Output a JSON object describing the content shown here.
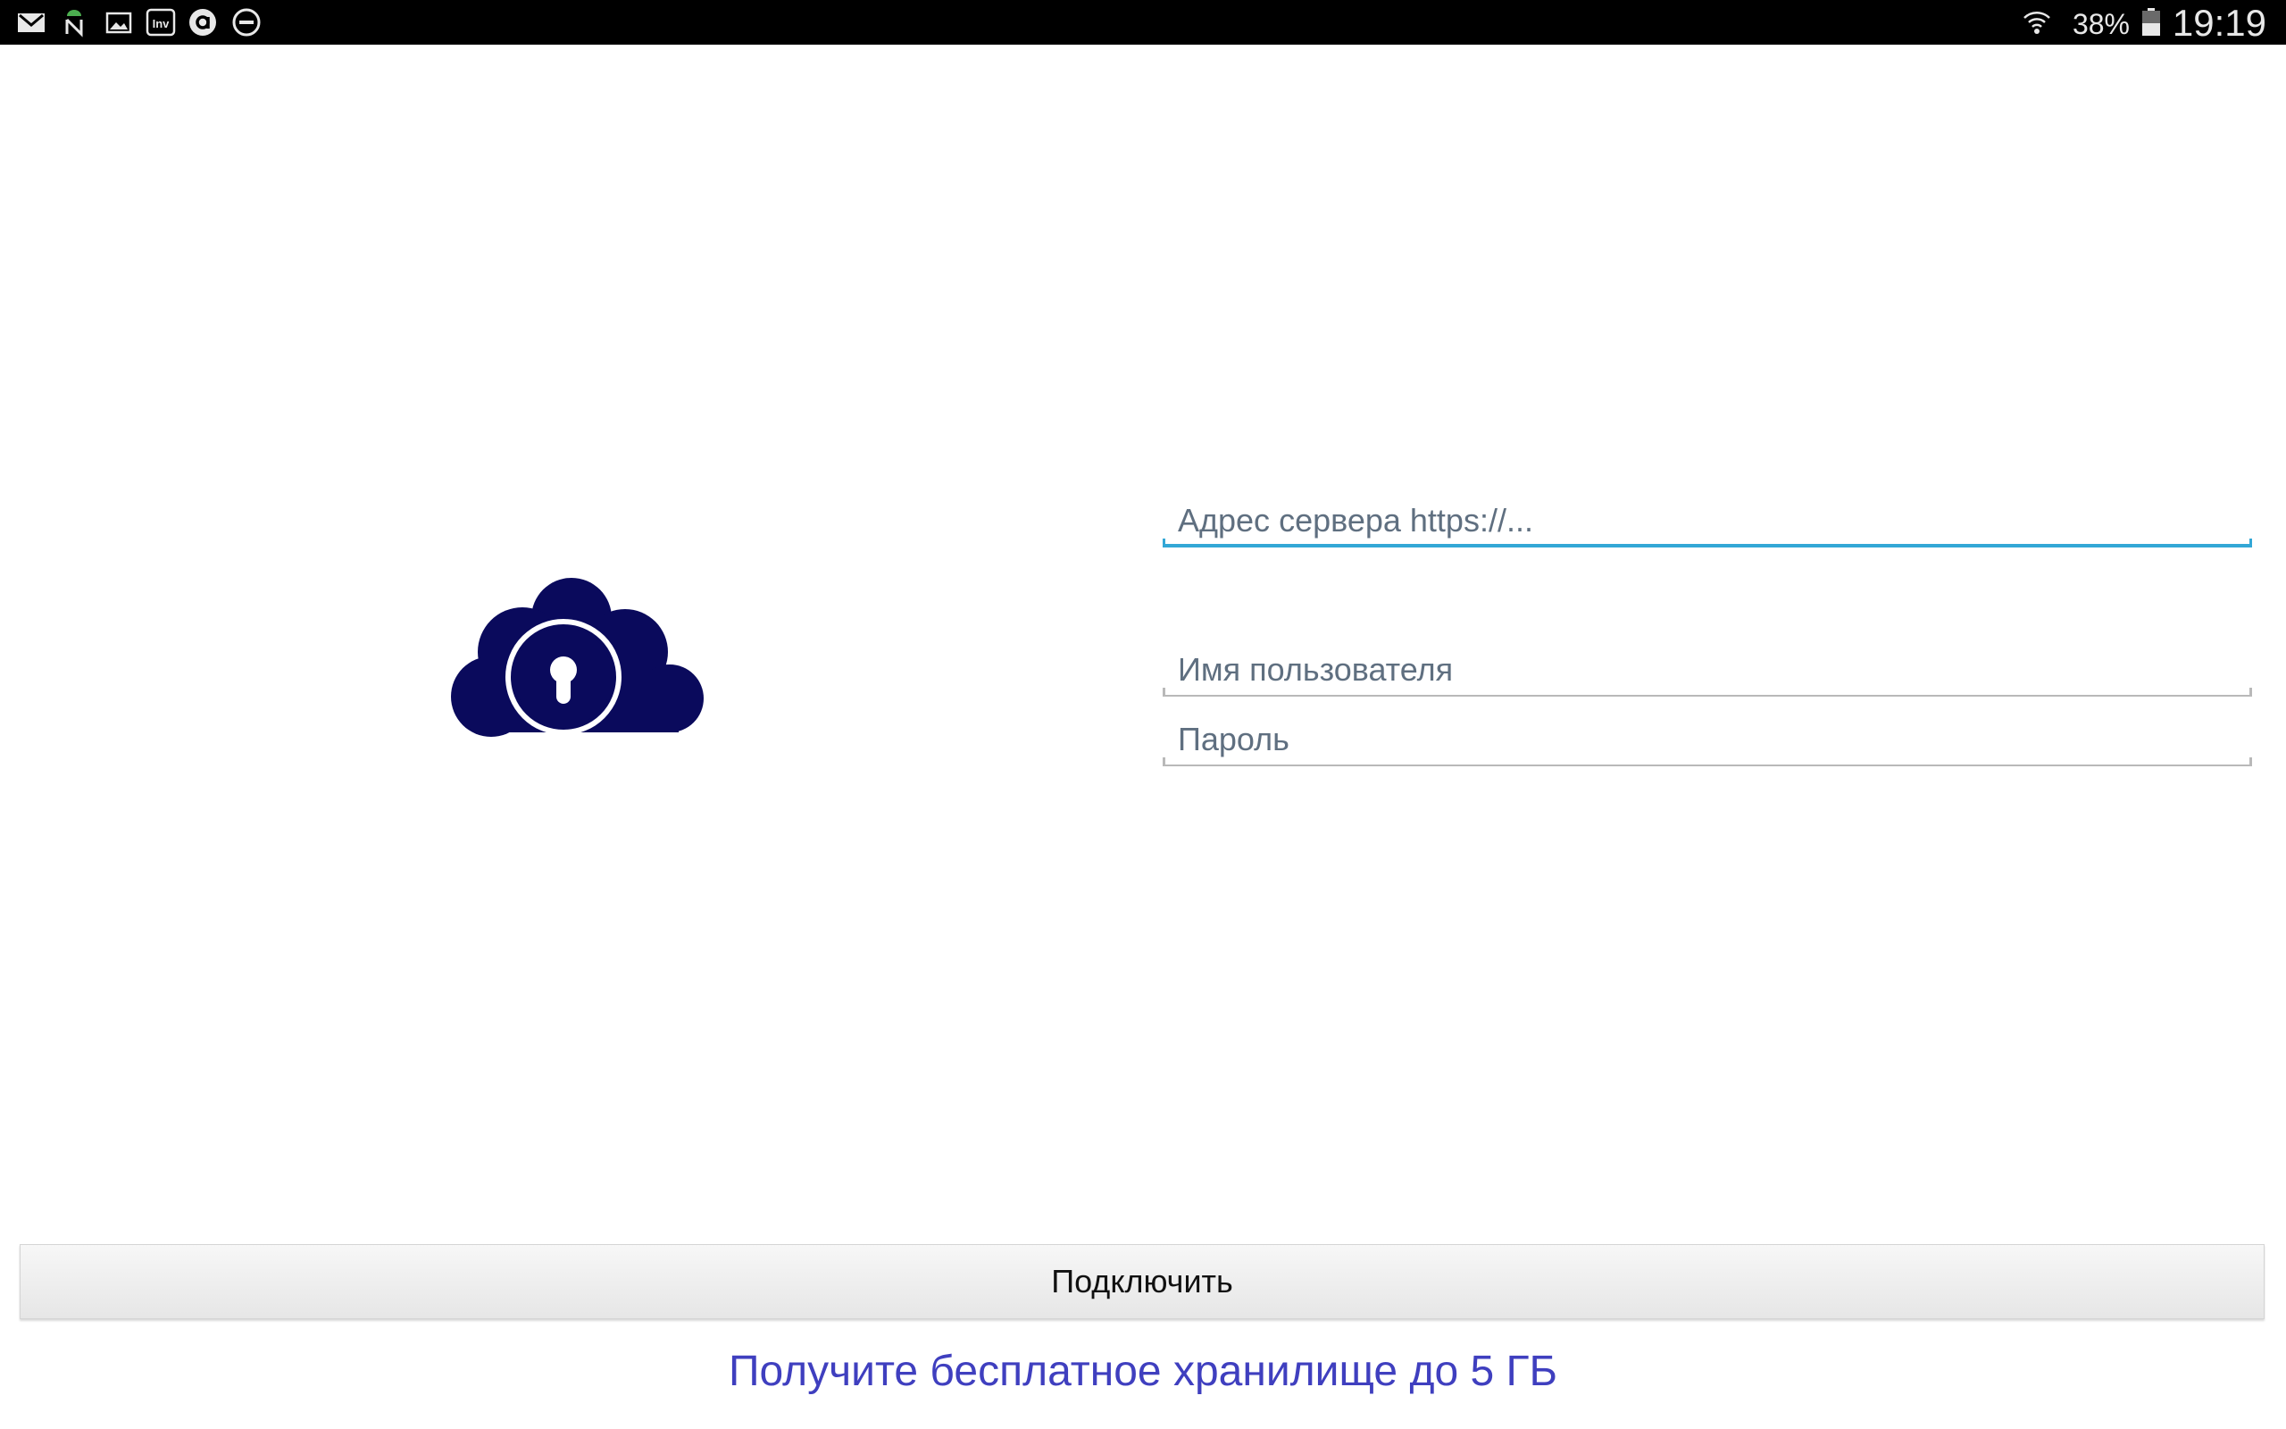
{
  "status_bar": {
    "notification_icons": [
      "gmail-icon",
      "android-n-icon",
      "gallery-icon",
      "inv-icon",
      "circle-a-icon",
      "do-not-disturb-icon"
    ],
    "battery_percent": "38%",
    "time": "19:19"
  },
  "login": {
    "server_placeholder": "Адрес сервера https://...",
    "username_placeholder": "Имя пользователя",
    "password_placeholder": "Пароль",
    "connect_label": "Подключить",
    "promo_link": "Получите бесплатное хранилище до 5 ГБ"
  },
  "colors": {
    "logo": "#0a0a5c",
    "focus_accent": "#33a7d6",
    "link": "#3f3fbf",
    "status_bar": "#000000"
  }
}
